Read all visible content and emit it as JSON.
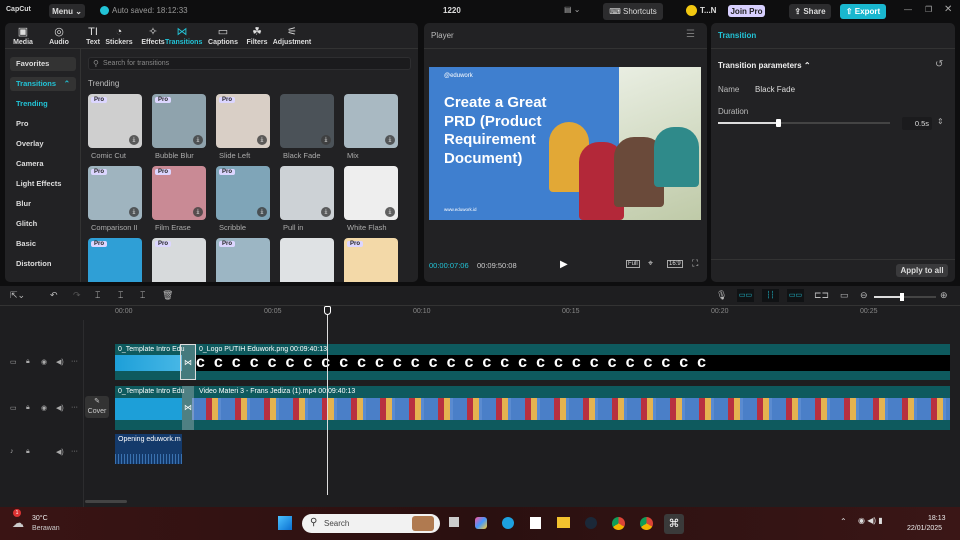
{
  "app": {
    "logo": "CapCut",
    "menu": "Menu",
    "autosave": "Auto saved: 18:12:33",
    "project": "1220",
    "shortcuts": "Shortcuts",
    "user": "T...N",
    "join_pro": "Join Pro",
    "share": "Share",
    "export": "Export"
  },
  "toolbar": {
    "tabs": [
      {
        "label": "Media",
        "icon": "▣"
      },
      {
        "label": "Audio",
        "icon": "◎"
      },
      {
        "label": "Text",
        "icon": "TI"
      },
      {
        "label": "Stickers",
        "icon": "◔"
      },
      {
        "label": "Effects",
        "icon": "✧"
      },
      {
        "label": "Transitions",
        "icon": "⋈"
      },
      {
        "label": "Captions",
        "icon": "▭"
      },
      {
        "label": "Filters",
        "icon": "☘"
      },
      {
        "label": "Adjustment",
        "icon": "⚟"
      }
    ]
  },
  "sidebar": {
    "favorites": "Favorites",
    "transitions": "Transitions",
    "items": [
      "Trending",
      "Pro",
      "Overlay",
      "Camera",
      "Light Effects",
      "Blur",
      "Glitch",
      "Basic",
      "Distortion"
    ]
  },
  "library": {
    "search_placeholder": "Search for transitions",
    "section": "Trending",
    "items": [
      {
        "label": "Comic Cut",
        "pro": "Pro",
        "bg": "#cfcfcf"
      },
      {
        "label": "Bubble Blur",
        "pro": "Pro",
        "bg": "#8fa3ad"
      },
      {
        "label": "Slide Left",
        "pro": "Pro",
        "bg": "#d9cfc6"
      },
      {
        "label": "Black Fade",
        "pro": "",
        "bg": "#4b5258"
      },
      {
        "label": "Mix",
        "pro": "",
        "bg": "#a9b9c2"
      },
      {
        "label": "Comparison II",
        "pro": "Pro",
        "bg": "#9fb4bf"
      },
      {
        "label": "Film Erase",
        "pro": "Pro",
        "bg": "#c98a95"
      },
      {
        "label": "Scribble",
        "pro": "Pro",
        "bg": "#7fa5b8"
      },
      {
        "label": "Pull in",
        "pro": "",
        "bg": "#cdd2d6"
      },
      {
        "label": "White Flash",
        "pro": "",
        "bg": "#eeeeee"
      },
      {
        "label": "",
        "pro": "Pro",
        "bg": "#2f9fd6"
      },
      {
        "label": "",
        "pro": "Pro",
        "bg": "#d7dadc"
      },
      {
        "label": "",
        "pro": "Pro",
        "bg": "#9cb6c4"
      },
      {
        "label": "",
        "pro": "",
        "bg": "#dfe2e4"
      },
      {
        "label": "",
        "pro": "Pro",
        "bg": "#f3d9a8"
      }
    ]
  },
  "player": {
    "title": "Player",
    "brand": "@eduwork",
    "headline": "Create a Great PRD (Product Requirement Document)",
    "url": "www.eduwork.id",
    "current": "00:00:07:06",
    "total": "00:09:50:08",
    "full": "Full",
    "ratio": "16:9"
  },
  "inspector": {
    "tab": "Transition",
    "section": "Transition parameters",
    "name_label": "Name",
    "name_value": "Black Fade",
    "duration_label": "Duration",
    "duration_value": "0.5s",
    "duration_fraction": 0.35,
    "apply_all": "Apply to all"
  },
  "timeline": {
    "ticks": [
      "00:00",
      "00:05",
      "00:10",
      "00:15",
      "00:20",
      "00:25"
    ],
    "zoom_fraction": 0.45,
    "cover": "Cover",
    "clips": {
      "intro1": "0_Template Intro Edu",
      "logo": "0_Logo PUTIH Eduwork.png  00:09:40:13",
      "intro2": "0_Template Intro Edu",
      "video": "Video Materi 3 - Frans Jediza (1).mp4  00:09:40:13",
      "audio": "Opening eduwork.m"
    }
  },
  "taskbar": {
    "temp": "30°C",
    "weather": "Berawan",
    "badge": "1",
    "search": "Search",
    "time": "18:13",
    "date": "22/01/2025"
  },
  "colors": {
    "accent": "#22c3d6",
    "export": "#19b7cf",
    "clip_teal": "#0e5a5e"
  }
}
